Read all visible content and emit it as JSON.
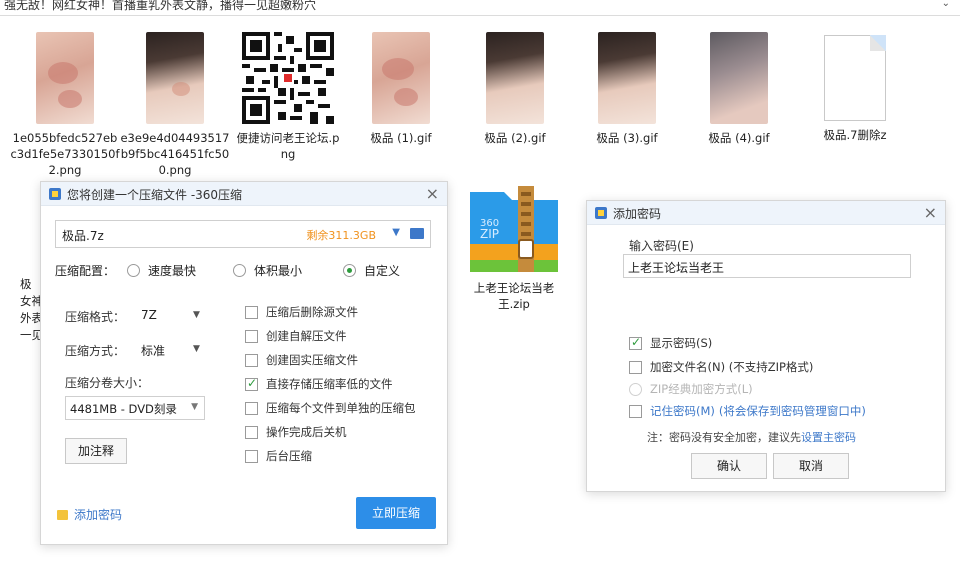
{
  "window": {
    "title_fragment": "强无敌！网红女神！首播重乳外表文静，播得一见超嫩粉穴"
  },
  "files": [
    {
      "name": "1e055bfedc527ebc3d1fe5e7330150f2.png",
      "thumb": "skin"
    },
    {
      "name": "e3e9e4d04493517b9f5bc416451fc500.png",
      "thumb": "hair"
    },
    {
      "name": "便捷访问老王论坛.png",
      "thumb": "qr"
    },
    {
      "name": "极品 (1).gif",
      "thumb": "skin"
    },
    {
      "name": "极品 (2).gif",
      "thumb": "hair"
    },
    {
      "name": "极品 (3).gif",
      "thumb": "hair"
    },
    {
      "name": "极品 (4).gif",
      "thumb": "dark"
    },
    {
      "name": "极品.7删除z",
      "thumb": "blank"
    }
  ],
  "left_partial": [
    "极",
    "女神",
    "外表",
    "一见"
  ],
  "zip_file": {
    "name": "上老王论坛当老王.zip",
    "icon_text": "360 ZIP"
  },
  "compress_dialog": {
    "title": "您将创建一个压缩文件 -360压缩",
    "filename": "极品.7z",
    "free_space": "剩余311.3GB",
    "config_label": "压缩配置：",
    "options": [
      "速度最快",
      "体积最小",
      "自定义"
    ],
    "format_label": "压缩格式：",
    "format_value": "7Z",
    "method_label": "压缩方式：",
    "method_value": "标准",
    "volume_label": "压缩分卷大小：",
    "volume_value": "4481MB  - DVD刻录",
    "comment_button": "加注释",
    "checks": [
      {
        "label": "压缩后删除源文件",
        "on": false
      },
      {
        "label": "创建自解压文件",
        "on": false
      },
      {
        "label": "创建固实压缩文件",
        "on": false
      },
      {
        "label": "直接存储压缩率低的文件",
        "on": true
      },
      {
        "label": "压缩每个文件到单独的压缩包",
        "on": false
      },
      {
        "label": "操作完成后关机",
        "on": false
      },
      {
        "label": "后台压缩",
        "on": false
      }
    ],
    "add_password": "添加密码",
    "start_button": "立即压缩"
  },
  "password_dialog": {
    "title": "添加密码",
    "input_label": "输入密码(E)",
    "input_value": "上老王论坛当老王",
    "show_password": "显示密码(S)",
    "encrypt_names": "加密文件名(N) (不支持ZIP格式)",
    "zip_classic": "ZIP经典加密方式(L)",
    "remember": "记住密码(M)",
    "remember_note": "(将会保存到密码管理窗口中)",
    "note": "注：密码没有安全加密，建议先",
    "note_link": "设置主密码",
    "ok": "确认",
    "cancel": "取消"
  },
  "colors": {
    "accent": "#2d8ee8",
    "checked": "#2e9b3d",
    "orange": "#f0921e"
  }
}
